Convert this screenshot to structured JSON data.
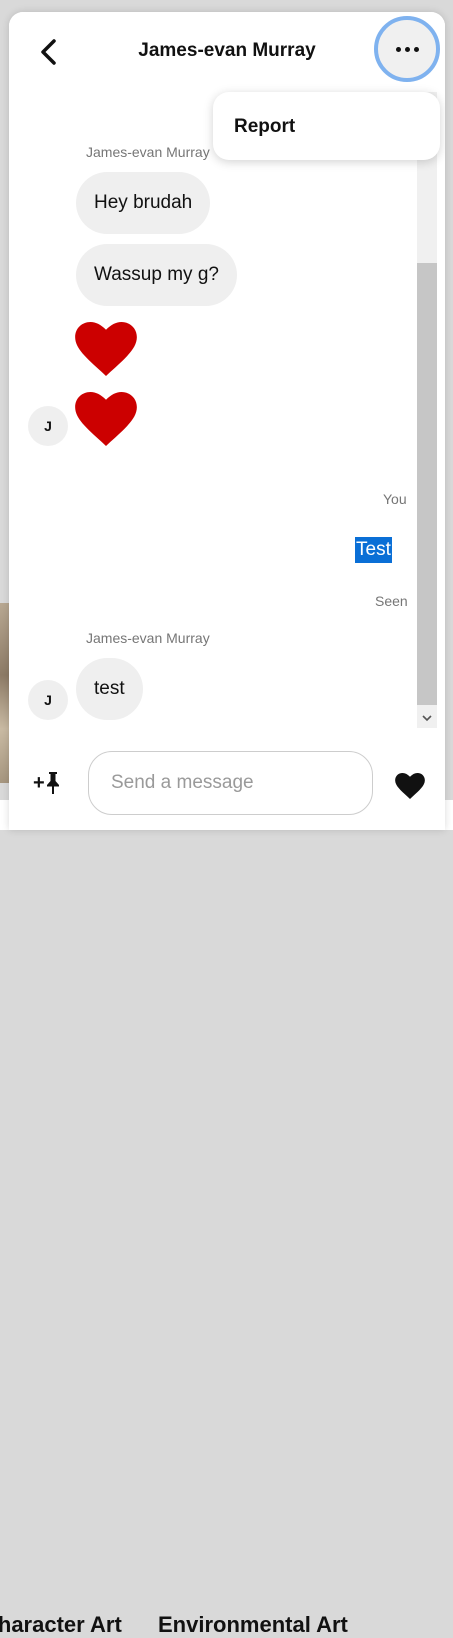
{
  "conversation": {
    "title": "James-evan Murray",
    "menu": {
      "report_label": "Report"
    }
  },
  "messages": {
    "group1": {
      "sender": "James-evan Murray",
      "bubbles": [
        "Hey brudah",
        "Wassup my g?"
      ],
      "hearts": 2,
      "avatar_initial": "J"
    },
    "outgoing": {
      "label": "You",
      "text": "Test",
      "status": "Seen"
    },
    "group2": {
      "sender": "James-evan Murray",
      "bubble": "test",
      "avatar_initial": "J"
    }
  },
  "composer": {
    "placeholder": "Send a message",
    "pin_label": "+"
  },
  "background": {
    "captions": [
      "Character Art",
      "Environmental Art"
    ]
  },
  "colors": {
    "heart": "#cc0000",
    "focus_ring": "#7fb2ef",
    "selection": "#0a6fd6",
    "bubble": "#efefef"
  }
}
